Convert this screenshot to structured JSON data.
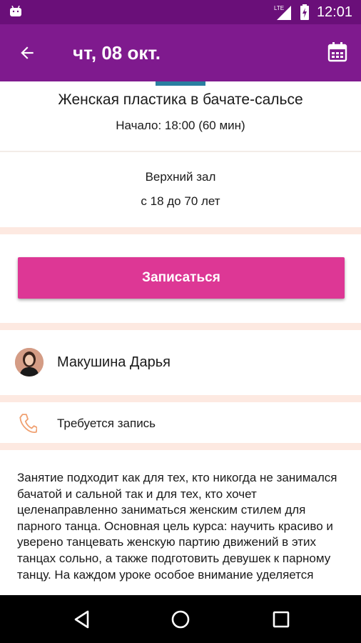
{
  "status_bar": {
    "network": "LTE",
    "time": "12:01"
  },
  "app_bar": {
    "title": "чт, 08 окт."
  },
  "class": {
    "title": "Женская пластика в бачате-сальсе",
    "start": "Начало: 18:00 (60 мин)"
  },
  "details": {
    "room": "Верхний зал",
    "age": "с 18 до 70 лет"
  },
  "signup_button": "Записаться",
  "trainer": {
    "name": "Макушина Дарья"
  },
  "booking": {
    "label": "Требуется запись"
  },
  "description": "Занятие подходит как для тех, кто никогда не занимался бачатой и сальной так и для тех, кто хочет целенаправленно заниматься женским стилем для парного танца. Основная цель курса: научить красиво и уверено танцевать женскую партию движений в этих танцах сольно, а также подготовить девушек к парному танцу. На каждом уроке особое внимание уделяется",
  "colors": {
    "app_bar": "#7f1a8e",
    "status_bar": "#6a0f79",
    "button": "#dd3795",
    "separator": "#fde9e1",
    "phone_icon": "#f0a070"
  },
  "icons": [
    "android-icon",
    "lte-signal-icon",
    "battery-charging-icon",
    "back-arrow-icon",
    "calendar-icon",
    "phone-icon",
    "nav-back-icon",
    "nav-home-icon",
    "nav-recents-icon"
  ]
}
